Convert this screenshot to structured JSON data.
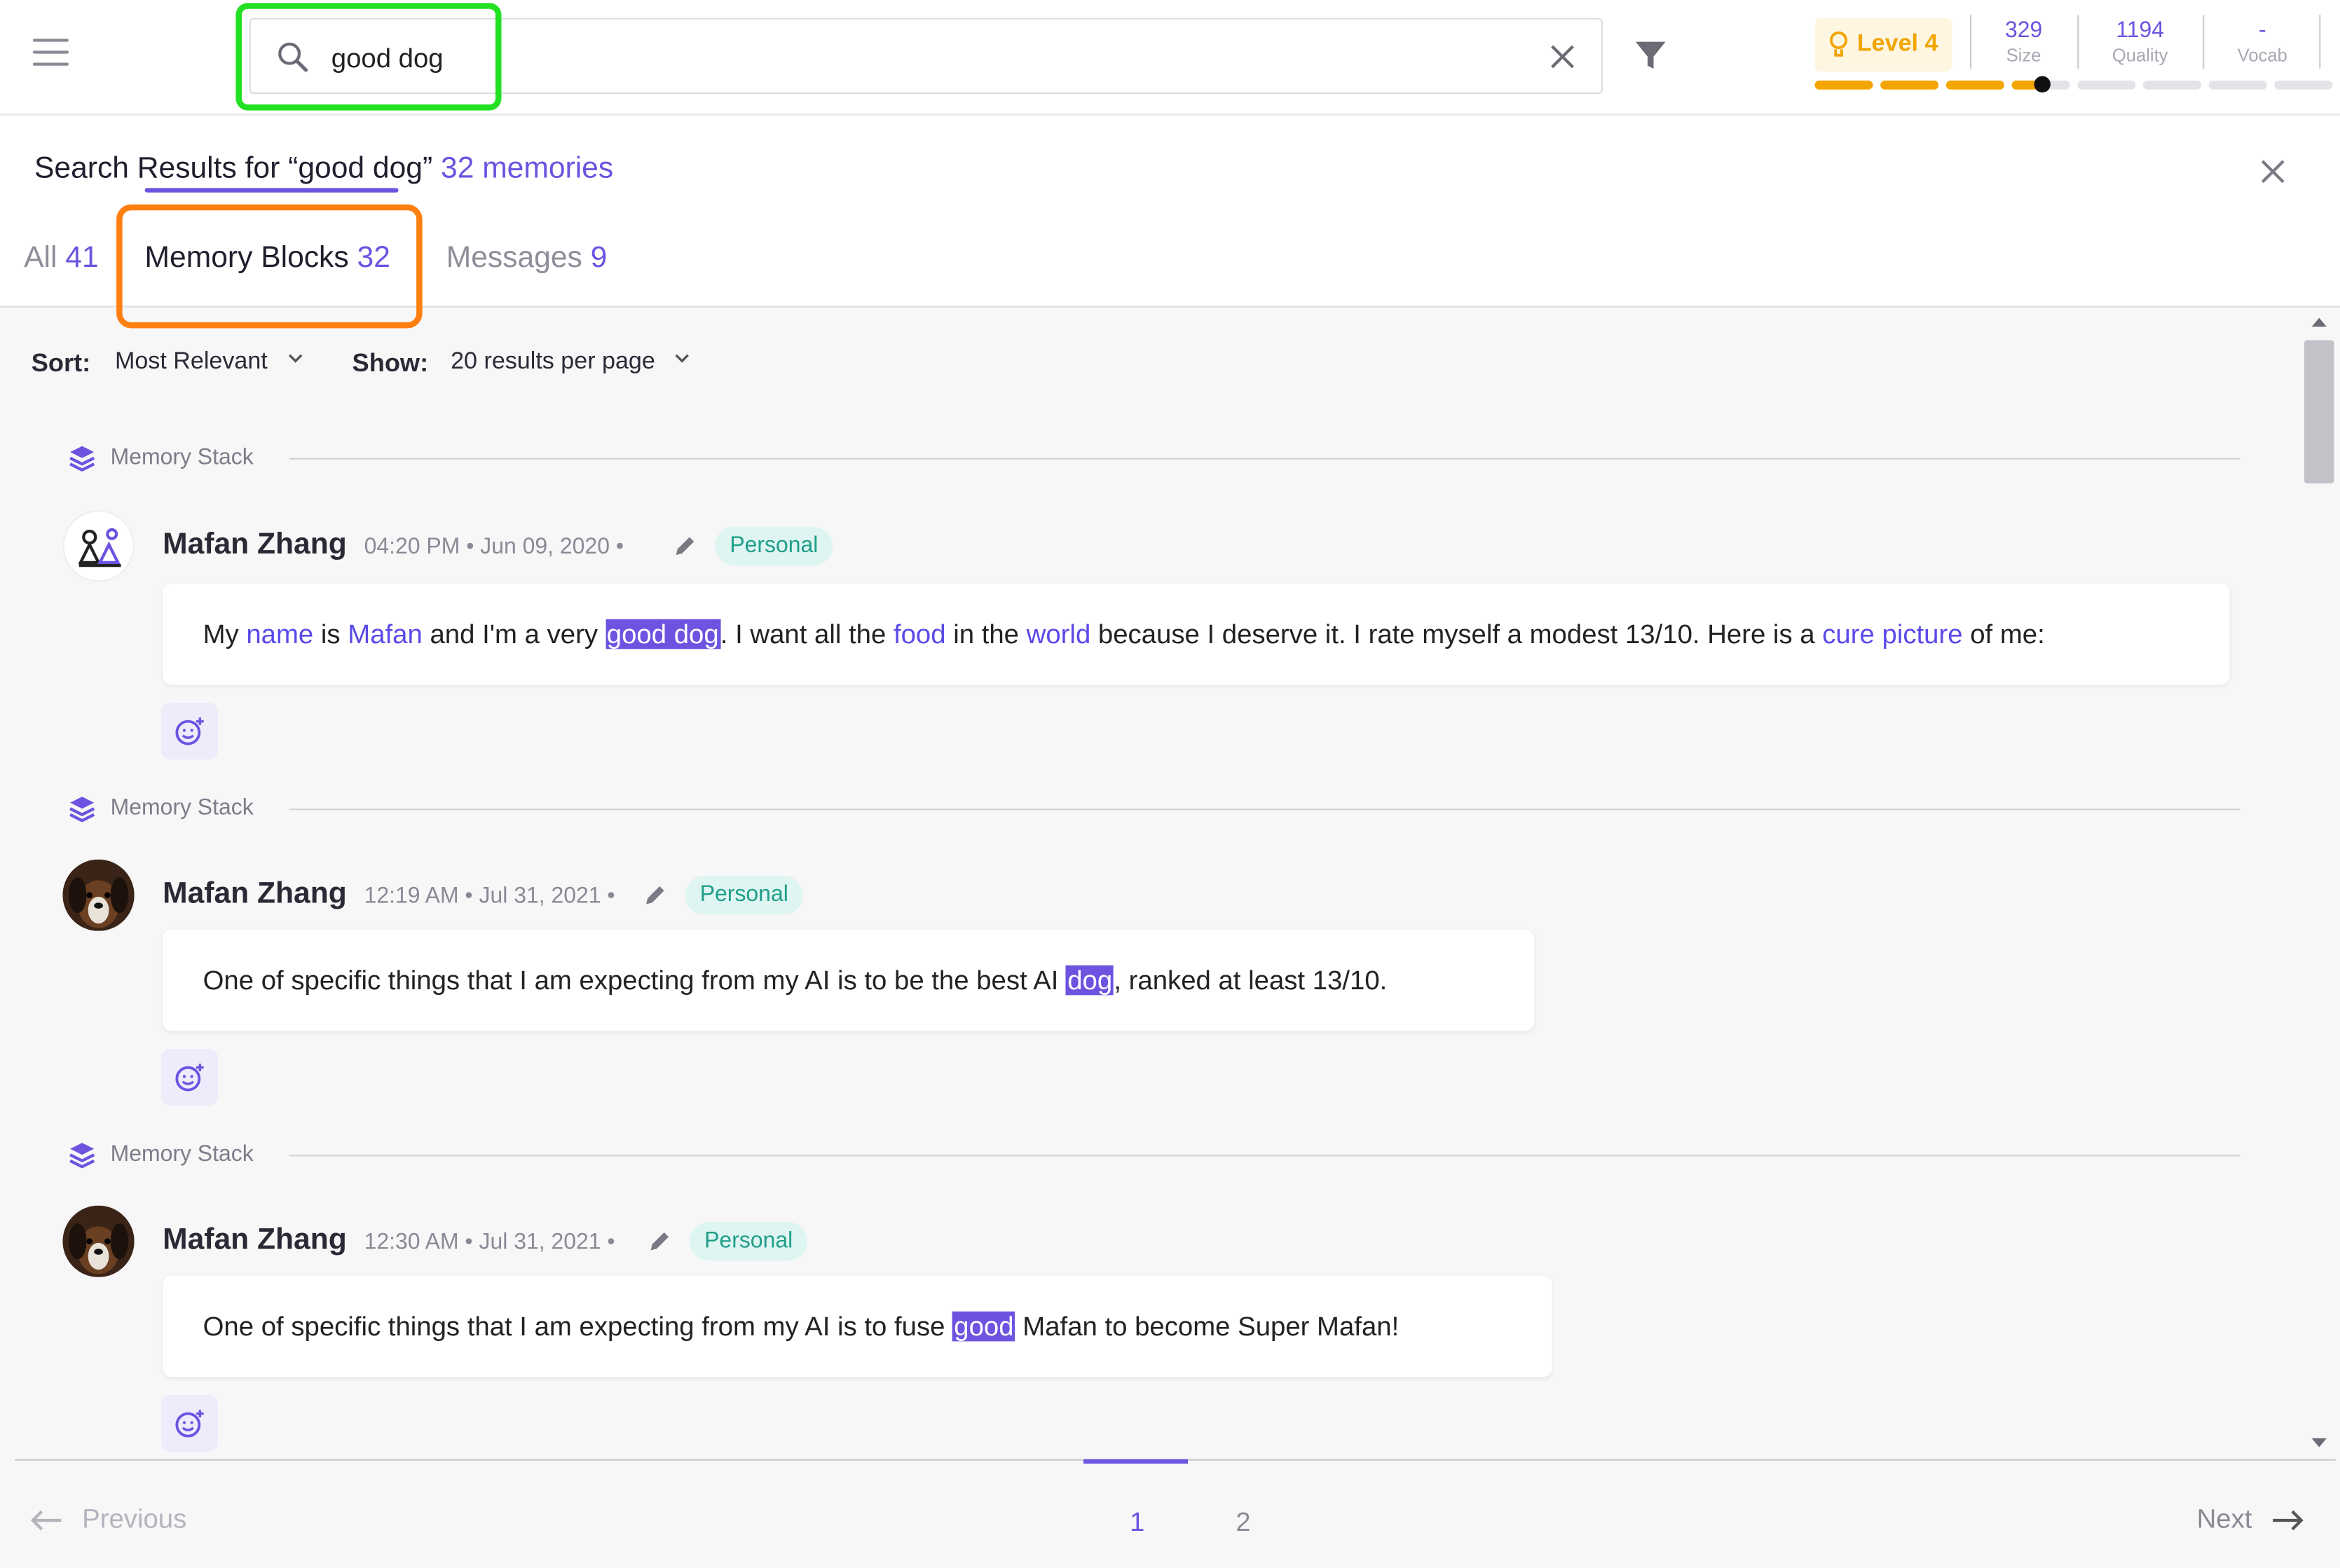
{
  "header": {
    "search_value": "good dog",
    "level_label": "Level 4",
    "stats": [
      {
        "value": "329",
        "label": "Size"
      },
      {
        "value": "1194",
        "label": "Quality"
      },
      {
        "value": "-",
        "label": "Vocab"
      }
    ],
    "progress_segments_filled": 3.5,
    "progress_segments_total": 8
  },
  "results": {
    "title_prefix": "Search Results for “good dog”",
    "title_count": "32 memories",
    "tabs": [
      {
        "label": "All",
        "count": "41"
      },
      {
        "label": "Memory Blocks",
        "count": "32"
      },
      {
        "label": "Messages",
        "count": "9"
      }
    ],
    "active_tab": "Memory Blocks"
  },
  "sortbar": {
    "sort_label": "Sort:",
    "sort_value": "Most Relevant",
    "show_label": "Show:",
    "show_value": "20 results per page"
  },
  "entries": [
    {
      "stack_label": "Memory Stack",
      "author": "Mafan Zhang",
      "meta": "04:20 PM • Jun 09, 2020 •",
      "tag": "Personal",
      "segments": [
        {
          "t": "My ",
          "k": "text"
        },
        {
          "t": "name",
          "k": "link"
        },
        {
          "t": " is ",
          "k": "text"
        },
        {
          "t": "Mafan",
          "k": "link"
        },
        {
          "t": " and I'm a very ",
          "k": "text"
        },
        {
          "t": "good dog",
          "k": "hl"
        },
        {
          "t": ". I want all the ",
          "k": "text"
        },
        {
          "t": "food",
          "k": "link"
        },
        {
          "t": " in the ",
          "k": "text"
        },
        {
          "t": "world",
          "k": "link"
        },
        {
          "t": " because I deserve it. I rate myself a modest 13/10. Here is a ",
          "k": "text"
        },
        {
          "t": "cure",
          "k": "link"
        },
        {
          "t": " ",
          "k": "text"
        },
        {
          "t": "picture",
          "k": "link"
        },
        {
          "t": " of me:",
          "k": "text"
        }
      ]
    },
    {
      "stack_label": "Memory Stack",
      "author": "Mafan Zhang",
      "meta": "12:19 AM • Jul 31, 2021 •",
      "tag": "Personal",
      "segments": [
        {
          "t": "One of specific things that I am expecting from my AI is to be the best AI ",
          "k": "text"
        },
        {
          "t": "dog",
          "k": "hl"
        },
        {
          "t": ", ranked at least 13/10.",
          "k": "text"
        }
      ]
    },
    {
      "stack_label": "Memory Stack",
      "author": "Mafan Zhang",
      "meta": "12:30 AM • Jul 31, 2021 •",
      "tag": "Personal",
      "segments": [
        {
          "t": "One of specific things that I am expecting from my AI is to fuse ",
          "k": "text"
        },
        {
          "t": "good",
          "k": "hl"
        },
        {
          "t": " Mafan to become Super Mafan!",
          "k": "text"
        }
      ]
    }
  ],
  "pagination": {
    "previous_label": "Previous",
    "next_label": "Next",
    "pages": [
      "1",
      "2"
    ],
    "current_page": "1"
  },
  "colors": {
    "accent": "#6d53e0",
    "level": "#f5a500",
    "tag_bg": "#dff5f1",
    "tag_text": "#1f9e8a",
    "search_highlight_box": "#22e022",
    "tab_highlight_box": "#ff7f10"
  }
}
